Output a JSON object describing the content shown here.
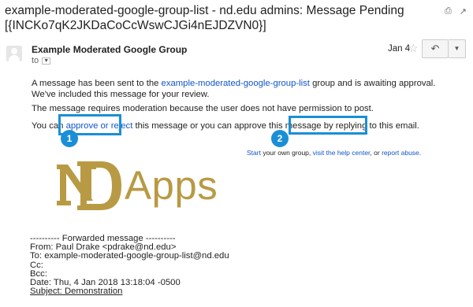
{
  "email": {
    "subject_line1": "example-moderated-google-group-list - nd.edu admins: Message Pending",
    "subject_line2": "[{INCKo7qK2JKDaCoCcWswCJGi4nEJDZVN0}]",
    "sender": "Example Moderated Google Group",
    "to_label": "to",
    "date": "Jan 4",
    "body": {
      "p1_pre": "A message has been sent to the ",
      "p1_link": "example-moderated-google-group-list",
      "p1_post": " group and is awaiting approval. We've included this message for your review.",
      "p2": "The message requires moderation because the user does not have permission to post.",
      "p3_pre": "You can ",
      "p3_link": "approve or reject",
      "p3_mid": " this message or you can approve this message by ",
      "p3_link2": "replying to this email",
      "p3_post": "."
    },
    "footer": {
      "start_link": "Start",
      "start_text": " your own group, ",
      "visit_link": "visit the help center",
      "or_text": ", or ",
      "report_link": "report abuse",
      "end": "."
    },
    "logo_text": "Apps",
    "forwarded": {
      "header": "---------- Forwarded message ----------",
      "from": "From: Paul Drake <pdrake@nd.edu>",
      "to": "To: example-moderated-google-group-list@nd.edu",
      "cc": "Cc:",
      "bcc": "Bcc:",
      "date": "Date: Thu, 4 Jan 2018 13:18:04 -0500",
      "subject": "Subject: Demonstration"
    }
  },
  "annotations": {
    "badge1": "1",
    "badge2": "2"
  },
  "icons": {
    "print": "print-icon",
    "popout": "popout-icon",
    "star": "star-icon",
    "reply": "reply-icon",
    "more": "chevron-down-icon"
  },
  "colors": {
    "link": "#1155cc",
    "highlight": "#1a8fd6",
    "nd_gold": "#b99a44"
  }
}
